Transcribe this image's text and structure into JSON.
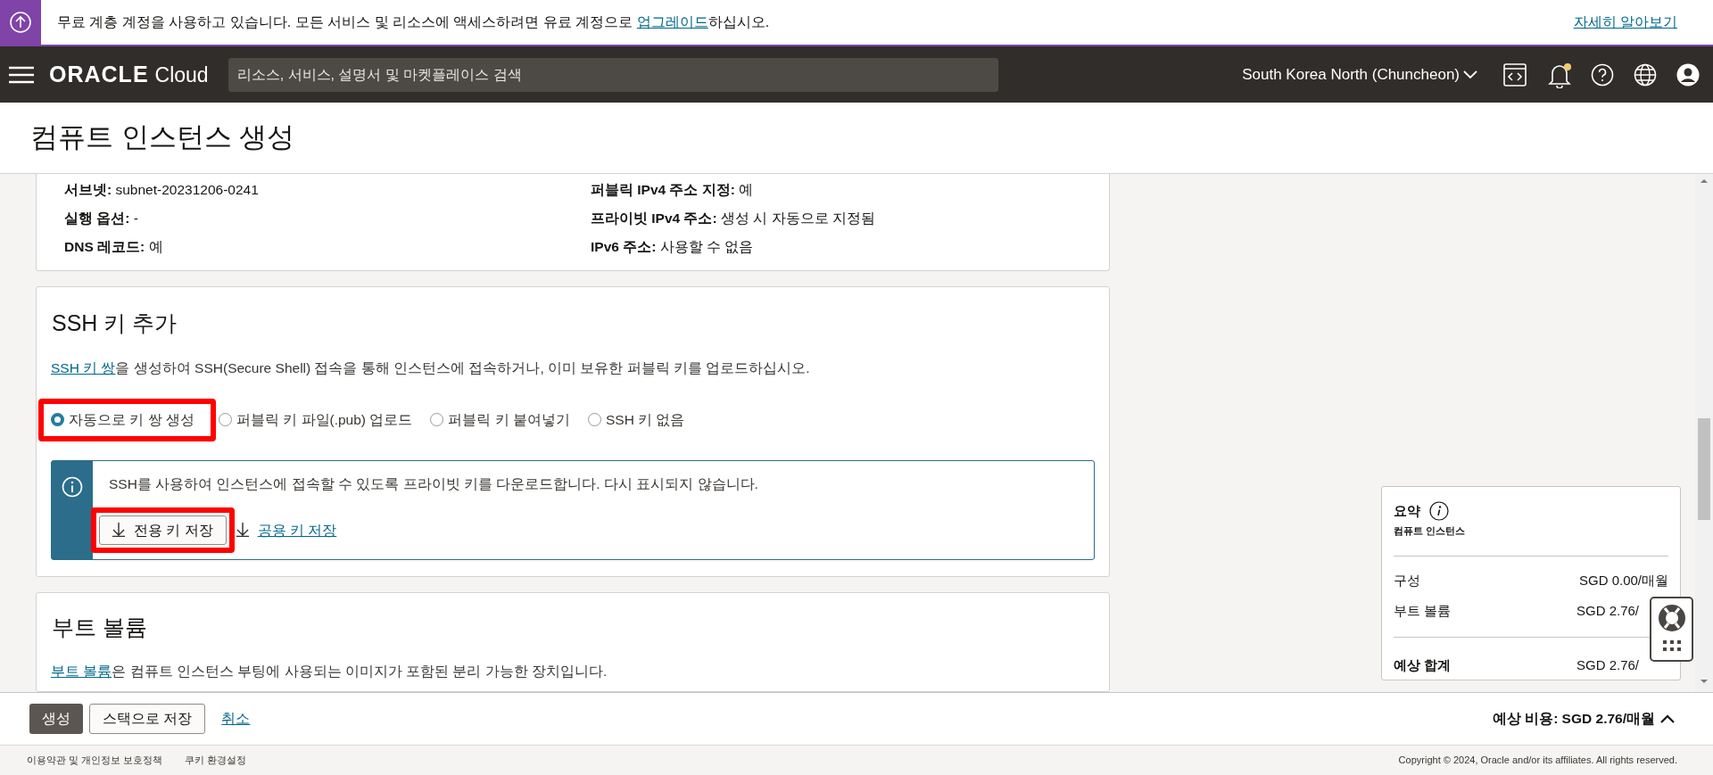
{
  "banner": {
    "message_before": "무료 계층 계정을 사용하고 있습니다. 모든 서비스 및 리소스에 액세스하려면 유료 계정으로 ",
    "link": "업그레이드",
    "message_after": "하십시오.",
    "learn_more": "자세히 알아보기"
  },
  "navbar": {
    "logo": {
      "brand": "ORACLE",
      "product": "Cloud"
    },
    "search": {
      "placeholder": "리소스, 서비스, 설명서 및 마켓플레이스 검색"
    },
    "region": "South Korea North (Chuncheon)",
    "has_notification": true
  },
  "page_title": "컴퓨트 인스턴스 생성",
  "networking_summary": {
    "left": [
      "**서브넷:** subnet-20231206-0241",
      "**실행 옵션:** -",
      "**DNS 레코드:** 예"
    ],
    "right": [
      "**퍼블릭 IPv4 주소 지정:** 예",
      "**프라이빗 IPv4 주소:** 생성 시 자동으로 지정됨",
      "**IPv6 주소:** 사용할 수 없음"
    ]
  },
  "ssh_section": {
    "title": "SSH 키 추가",
    "description_link": "SSH 키 쌍",
    "description": "을 생성하여 SSH(Secure Shell) 접속을 통해 인스턴스에 접속하거나, 이미 보유한 퍼블릭 키를 업로드하십시오.",
    "options": [
      {
        "label": "자동으로 키 쌍 생성",
        "selected": true,
        "highlighted": true
      },
      {
        "label": "퍼블릭 키 파일(.pub) 업로드",
        "selected": false,
        "highlighted": false
      },
      {
        "label": "퍼블릭 키 붙여넣기",
        "selected": false,
        "highlighted": false
      },
      {
        "label": "SSH 키 없음",
        "selected": false,
        "highlighted": false
      }
    ],
    "info": {
      "message": "SSH를 사용하여 인스턴스에 접속할 수 있도록 프라이빗 키를 다운로드합니다. 다시 표시되지 않습니다.",
      "private_key_button": "전용 키 저장",
      "private_key_highlighted": true,
      "public_key_link": "공용 키 저장"
    }
  },
  "boot_volume_section": {
    "title": "부트 볼륨",
    "description_link": "부트 볼륨",
    "description": "은 컴퓨트 인스턴스 부팅에 사용되는 이미지가 포함된 분리 가능한 장치입니다."
  },
  "summary": {
    "title": "요약",
    "subtitle": "컴퓨트 인스턴스",
    "rows": [
      {
        "label": "구성",
        "value": "SGD 0.00/매월"
      },
      {
        "label": "부트 볼륨",
        "value": "SGD 2.76/"
      }
    ],
    "total": {
      "label": "예상 합계",
      "value": "SGD 2.76/"
    }
  },
  "action_bar": {
    "create_button": "생성",
    "save_stack_button": "스택으로 저장",
    "cancel_link": "취소",
    "estimated_cost": "예상 비용: SGD 2.76/매월"
  },
  "footer": {
    "links": [
      "이용약관 및 개인정보 보호정책",
      "쿠키 환경설정"
    ],
    "copyright": "Copyright © 2024, Oracle and/or its affiliates. All rights reserved."
  }
}
